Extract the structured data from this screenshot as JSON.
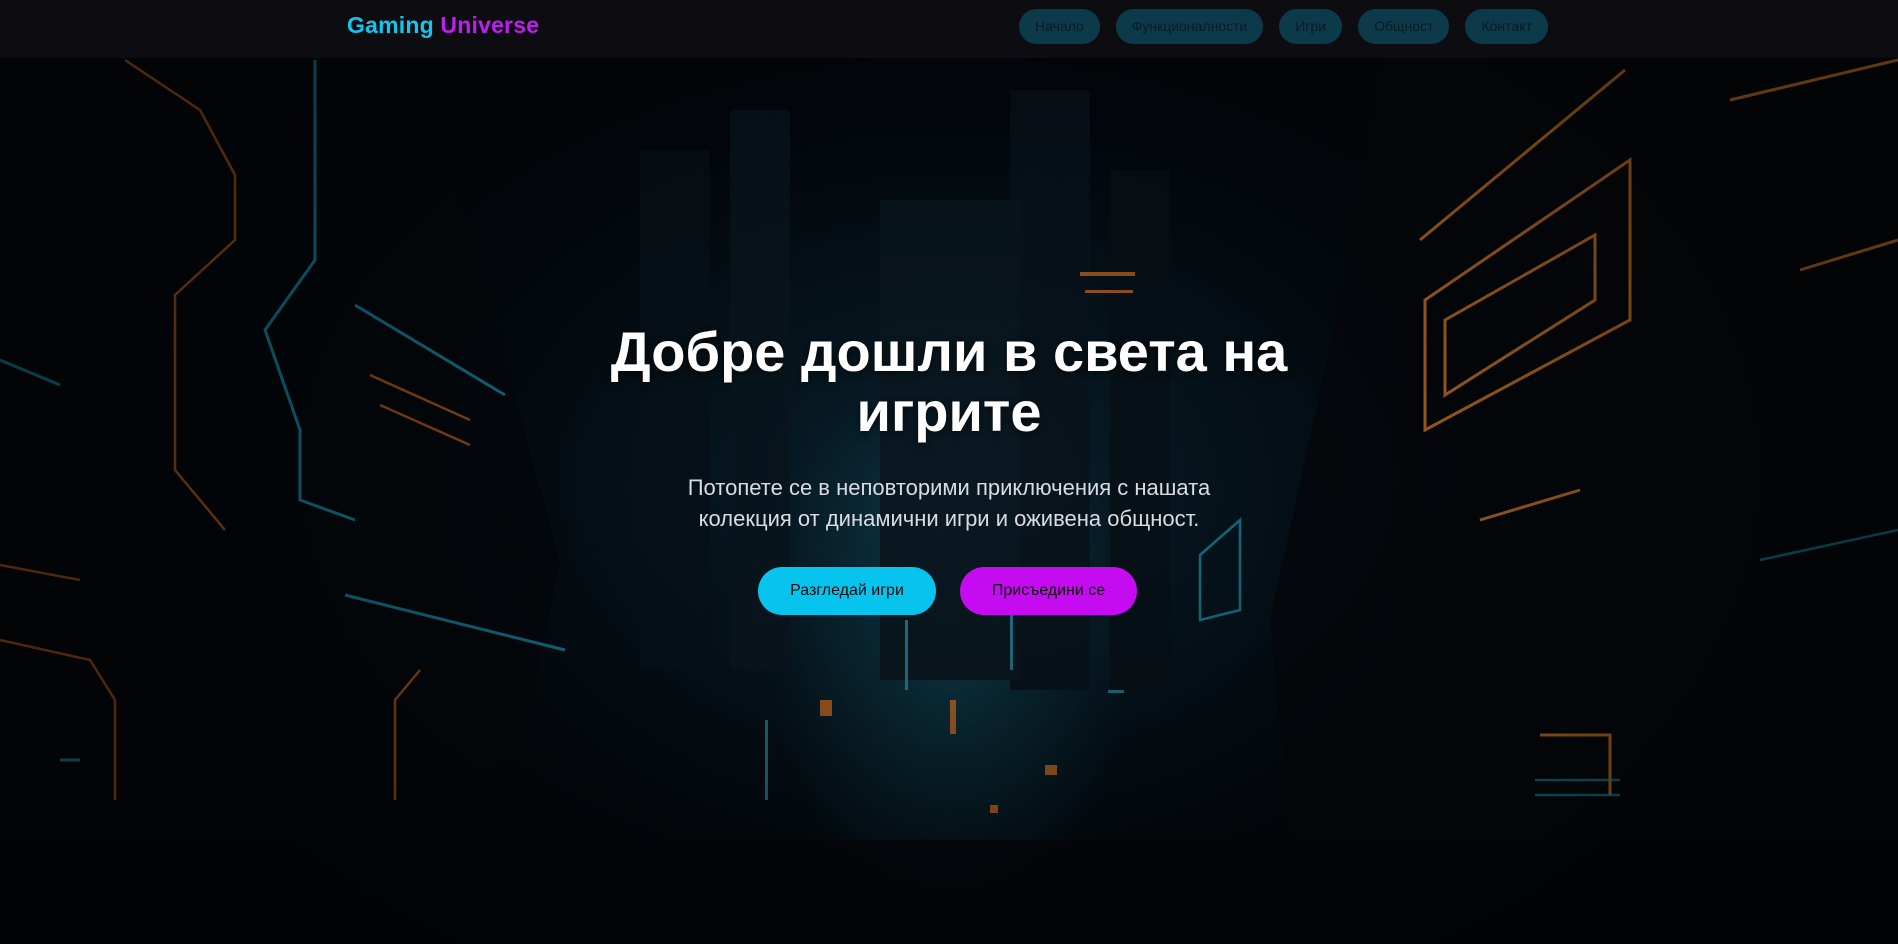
{
  "brand": {
    "part1": "Gaming",
    "part2": "Universe",
    "color1": "#12c6ee",
    "color2": "#c01df0"
  },
  "nav": {
    "items": [
      {
        "label": "Начало"
      },
      {
        "label": "Функционалности"
      },
      {
        "label": "Игри"
      },
      {
        "label": "Общност"
      },
      {
        "label": "Контакт"
      }
    ],
    "pill_color": "#0d3a4b"
  },
  "hero": {
    "title": "Добре дошли в света на игрите",
    "subtitle": "Потопете се в неповторими приключения с нашата колекция от динамични игри и оживена общност.",
    "buttons": {
      "games": {
        "label": "Разгледай игри",
        "color": "#07c4ef"
      },
      "join": {
        "label": "Присъедини се",
        "color": "#c50cf1"
      }
    },
    "background_image": "neon-cyberpunk-city-street"
  }
}
